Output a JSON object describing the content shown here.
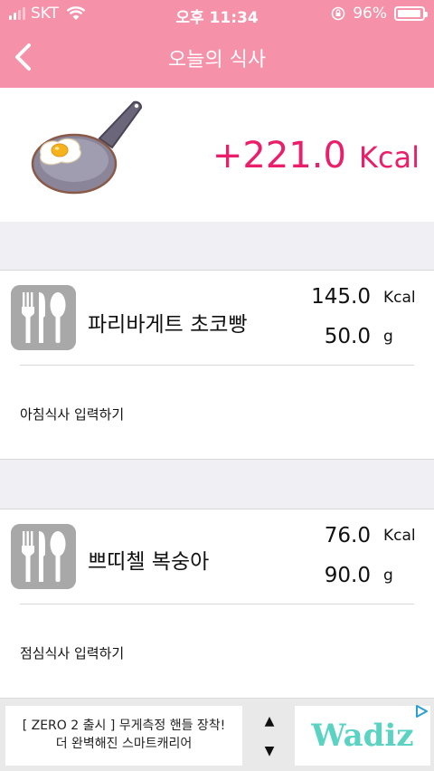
{
  "status": {
    "carrier": "SKT",
    "time": "오후 11:34",
    "battery": "96%",
    "battery_level": 0.96
  },
  "nav": {
    "title": "오늘의 식사",
    "back_icon": "chevron-left-icon"
  },
  "summary": {
    "total": "+221.0",
    "unit": "Kcal",
    "image": "frying-pan-egg-icon"
  },
  "meals": [
    {
      "food": "파리바게트 초코빵",
      "kcal": "145.0",
      "kcal_unit": "Kcal",
      "weight": "50.0",
      "weight_unit": "g",
      "add_label": "아침식사 입력하기"
    },
    {
      "food": "쁘띠첼 복숭아",
      "kcal": "76.0",
      "kcal_unit": "Kcal",
      "weight": "90.0",
      "weight_unit": "g",
      "add_label": "점심식사 입력하기"
    }
  ],
  "ad": {
    "line1": "[ ZERO 2 출시 ] 무게측정 핸들 장착!",
    "line2": "더 완벽해진 스마트캐리어",
    "brand": "Wadiz",
    "up": "▲",
    "down": "▼"
  },
  "colors": {
    "accent": "#f592aa",
    "kcal": "#ea1e6a",
    "brand": "#5ad3c3"
  }
}
